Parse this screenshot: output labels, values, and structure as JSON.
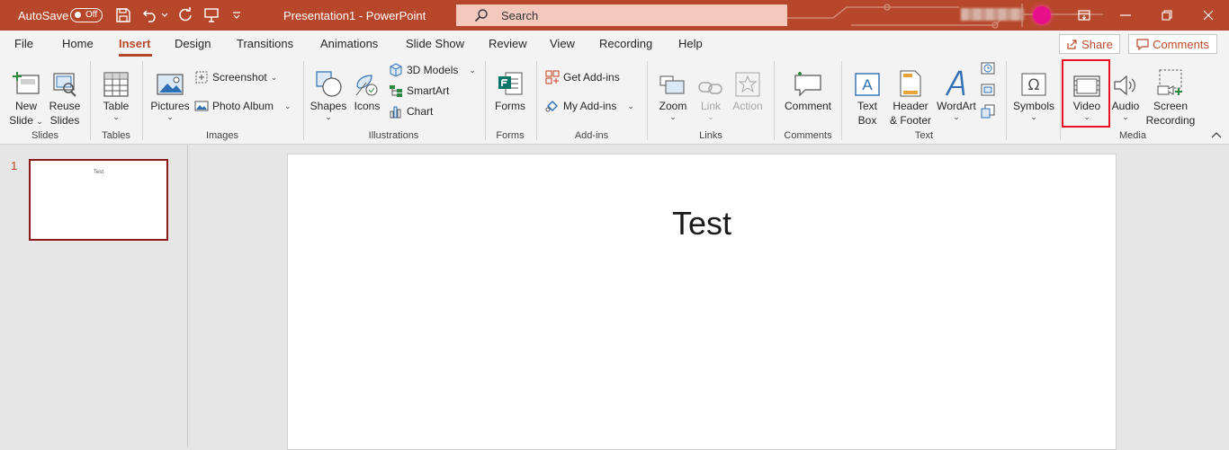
{
  "titlebar": {
    "autosave_label": "AutoSave",
    "autosave_state": "Off",
    "document_title": "Presentation1  -  PowerPoint",
    "search_placeholder": "Search",
    "accent_color": "#b7472a"
  },
  "tabs": [
    {
      "label": "File"
    },
    {
      "label": "Home"
    },
    {
      "label": "Insert",
      "active": true
    },
    {
      "label": "Design"
    },
    {
      "label": "Transitions"
    },
    {
      "label": "Animations"
    },
    {
      "label": "Slide Show"
    },
    {
      "label": "Review"
    },
    {
      "label": "View"
    },
    {
      "label": "Recording"
    },
    {
      "label": "Help"
    }
  ],
  "share_label": "Share",
  "comments_label": "Comments",
  "ribbon": {
    "slides": {
      "new_slide": "New Slide",
      "new_slide_line1": "New",
      "new_slide_line2": "Slide",
      "reuse_line1": "Reuse",
      "reuse_line2": "Slides",
      "group": "Slides"
    },
    "tables": {
      "table": "Table",
      "group": "Tables"
    },
    "images": {
      "pictures": "Pictures",
      "screenshot": "Screenshot",
      "photo_album": "Photo Album",
      "group": "Images"
    },
    "illustrations": {
      "shapes": "Shapes",
      "icons": "Icons",
      "models": "3D Models",
      "smartart": "SmartArt",
      "chart": "Chart",
      "group": "Illustrations"
    },
    "forms": {
      "forms": "Forms",
      "group": "Forms"
    },
    "addins": {
      "get": "Get Add-ins",
      "my": "My Add-ins",
      "group": "Add-ins"
    },
    "links": {
      "zoom": "Zoom",
      "link": "Link",
      "action": "Action",
      "group": "Links"
    },
    "comments": {
      "comment": "Comment",
      "group": "Comments"
    },
    "text": {
      "textbox_line1": "Text",
      "textbox_line2": "Box",
      "hf_line1": "Header",
      "hf_line2": "& Footer",
      "wordart": "WordArt",
      "group": "Text"
    },
    "symbols": {
      "symbols": "Symbols"
    },
    "media": {
      "video": "Video",
      "audio": "Audio",
      "sr_line1": "Screen",
      "sr_line2": "Recording",
      "group": "Media"
    }
  },
  "slides": [
    {
      "number": "1",
      "title": "Test"
    }
  ],
  "highlight_color": "#e81123"
}
